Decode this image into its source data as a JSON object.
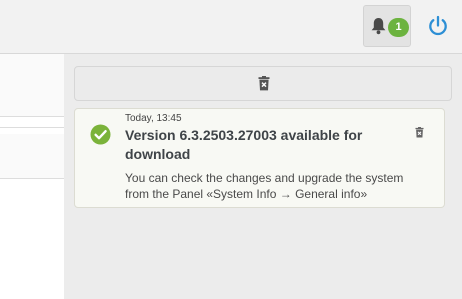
{
  "header": {
    "notifications": {
      "count": "1",
      "icon": "bell-icon",
      "badge_color": "#6cb33f"
    },
    "power": {
      "icon": "power-icon",
      "color": "#2d8fd5"
    }
  },
  "notifications_panel": {
    "clear_all": {
      "icon": "trash-icon"
    },
    "items": [
      {
        "time": "Today, 13:45",
        "title": "Version 6.3.2503.27003 available for download",
        "body": "You can check the changes and upgrade the system from the Panel «System Info → General info»",
        "status_icon": "check-circle-icon",
        "status_color": "#7bb33a",
        "dismiss_icon": "trash-icon"
      }
    ]
  }
}
